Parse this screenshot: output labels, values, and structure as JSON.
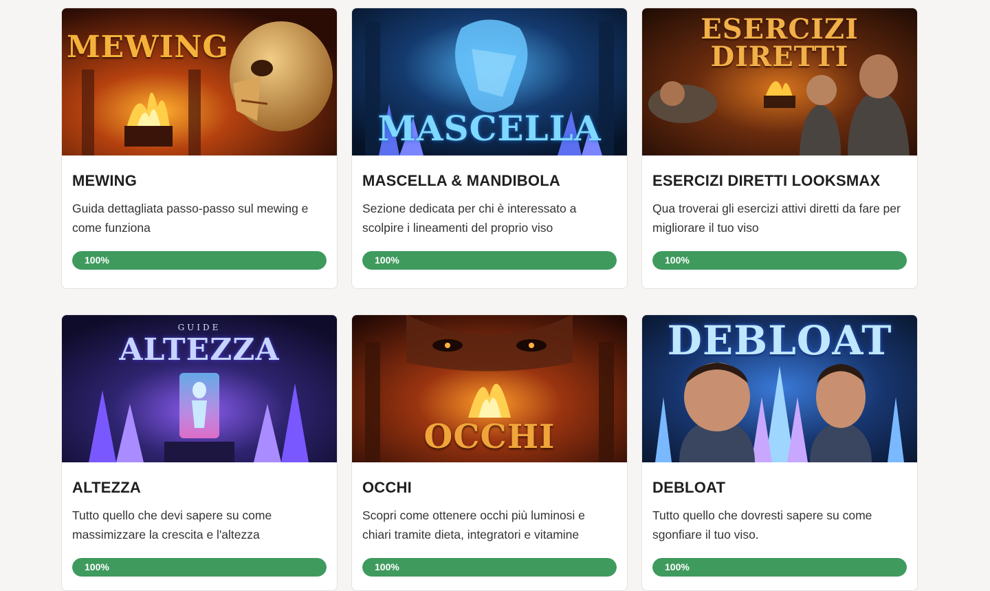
{
  "courses": [
    {
      "image_title": "MEWING",
      "image_subtitle": "",
      "title": "MEWING",
      "description": "Guida dettagliata passo-passo sul mewing e come funziona",
      "progress_label": "100%",
      "progress": 1.0
    },
    {
      "image_title": "MASCELLA",
      "image_subtitle": "",
      "title": "MASCELLA & MANDIBOLA",
      "description": "Sezione dedicata per chi è interessato a scolpire i lineamenti del proprio viso",
      "progress_label": "100%",
      "progress": 1.0
    },
    {
      "image_title": "ESERCIZI",
      "image_title_2": "DIRETTI",
      "image_subtitle": "",
      "title": "ESERCIZI DIRETTI LOOKSMAX",
      "description": "Qua troverai gli esercizi attivi diretti da fare per migliorare il tuo viso",
      "progress_label": "100%",
      "progress": 1.0
    },
    {
      "image_title": "ALTEZZA",
      "image_subtitle": "GUIDE",
      "title": "ALTEZZA",
      "description": "Tutto quello che devi sapere su come massimizzare la crescita e l'altezza",
      "progress_label": "100%",
      "progress": 1.0
    },
    {
      "image_title": "OCCHI",
      "image_subtitle": "",
      "title": "OCCHI",
      "description": "Scopri come ottenere occhi più luminosi e chiari tramite dieta, integratori e vitamine",
      "progress_label": "100%",
      "progress": 1.0
    },
    {
      "image_title": "DEBLOAT",
      "image_subtitle": "",
      "title": "DEBLOAT",
      "description": "Tutto quello che dovresti sapere su come sgonfiare il tuo viso.",
      "progress_label": "100%",
      "progress": 1.0
    }
  ],
  "colors": {
    "progress": "#3f9a5e",
    "background": "#f6f5f3"
  }
}
